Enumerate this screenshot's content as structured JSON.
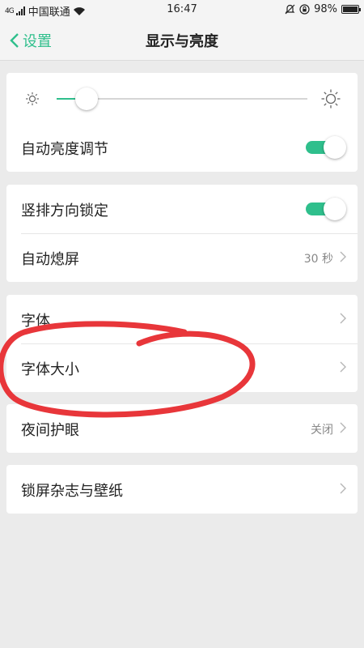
{
  "status_bar": {
    "signal_text": "4G",
    "carrier": "中国联通",
    "time": "16:47",
    "battery": "98%",
    "battery_level": 0.98
  },
  "nav": {
    "back_label": "设置",
    "title": "显示与亮度"
  },
  "brightness": {
    "level": 0.12,
    "auto_label": "自动亮度调节",
    "auto_on": true
  },
  "orientation": {
    "lock_label": "竖排方向锁定",
    "lock_on": true,
    "sleep_label": "自动熄屏",
    "sleep_value": "30 秒"
  },
  "font": {
    "font_label": "字体",
    "size_label": "字体大小"
  },
  "night": {
    "label": "夜间护眼",
    "value": "关闭"
  },
  "wallpaper": {
    "label": "锁屏杂志与壁纸"
  },
  "colors": {
    "accent": "#2fbf8c",
    "annotation": "#e8363a"
  }
}
